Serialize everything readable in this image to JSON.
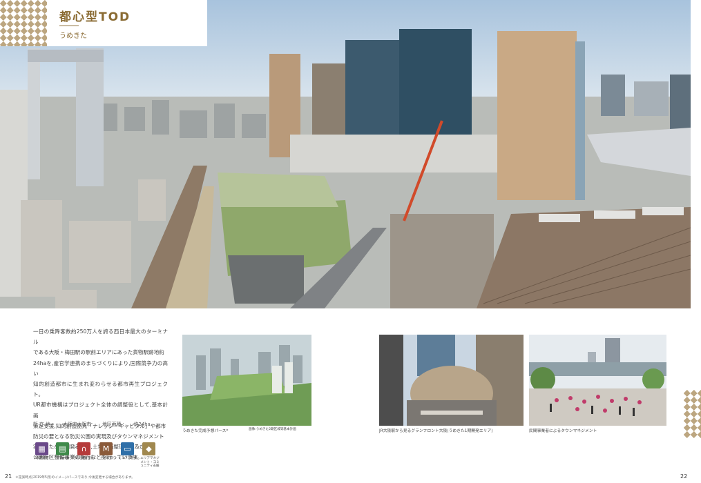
{
  "title": "都心型TOD",
  "subtitle": "うめきた",
  "body_lines": [
    "一日の乗降客数約250万人を誇る西日本最大のターミナル",
    "である大阪・梅田駅の駅前エリアにあった貨物駅跡地約",
    "24haを,産官学連携のまちづくりにより,国際競争力の高い",
    "知的創造都市に生まれ変わらせる都市再生プロジェクト。",
    "UR都市機構はプロジェクト全体の調整役として,基本計画",
    "策定支援,知的創造拠点「ナレッジ・キャピタル」や都市",
    "防災の要となる防災公園の実現及びタウンマネジメント",
    "実施のための開発者誘導,土地区画整理事業及び防災",
    "公園街区整備事業の施行などを行っています。"
  ],
  "meta": {
    "location_label": "所 在 地 :",
    "location_value": "大阪府大阪市",
    "area_label": "地区面積 :",
    "area_value": "約24ha"
  },
  "icons": [
    {
      "name": "planning",
      "label": "事業調整",
      "color": "#6b4a8a",
      "glyph": "▦"
    },
    {
      "name": "urban",
      "label": "開発共生",
      "color": "#3f8a4a",
      "glyph": "▤"
    },
    {
      "name": "disaster",
      "label": "防災機能強化",
      "color": "#b53b3b",
      "glyph": "∩"
    },
    {
      "name": "land",
      "label": "土地取得",
      "color": "#8a5a3a",
      "glyph": "M"
    },
    {
      "name": "infra",
      "label": "インフラ整備",
      "color": "#2f6fa8",
      "glyph": "▭"
    },
    {
      "name": "area",
      "label": "エリアマネジメント・コミュニティ支援",
      "color": "#a0884f",
      "glyph": "◆"
    }
  ],
  "captions": {
    "photo1": "うめきた完成予想パース*",
    "photo1_credit": "画像:うめきた2期区域等基本計画",
    "photo2": "JR大阪駅から見るグランフロント大阪(うめきた1期開発エリア)",
    "photo3": "民間事業者によるタウンマネジメント"
  },
  "page_left": "21",
  "page_right": "22",
  "footnote": "＊提案時点(2019年5月)のイメージパースであり,今後変更する場合があります。"
}
